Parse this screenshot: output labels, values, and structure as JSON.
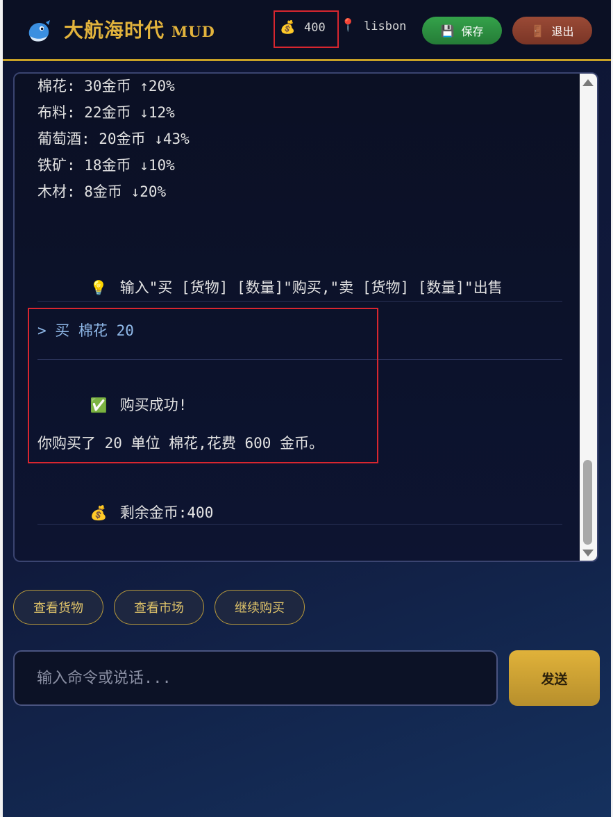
{
  "header": {
    "title": "大航海时代",
    "title_suffix": "MUD",
    "gold_icon": "💰",
    "gold": "400",
    "location_icon": "📍",
    "location": "lisbon",
    "save_icon": "💾",
    "save_label": "保存",
    "exit_icon": "🚪",
    "exit_label": "退出"
  },
  "log": {
    "market_lines": [
      "棉花: 30金币 ↑20%",
      "布料: 22金币 ↓12%",
      "葡萄酒: 20金币 ↓43%",
      "铁矿: 18金币 ↓10%",
      "木材: 8金币 ↓20%"
    ],
    "hint_icon": "💡",
    "hint": "输入\"买 [货物] [数量]\"购买,\"卖 [货物] [数量]\"出售",
    "command": "> 买 棉花 20",
    "success_icon": "✅",
    "success": "购买成功!",
    "detail": "你购买了 20 单位 棉花,花费 600 金币。",
    "remaining_icon": "💰",
    "remaining": "剩余金币:400"
  },
  "quick_actions": [
    "查看货物",
    "查看市场",
    "继续购买"
  ],
  "input": {
    "placeholder": "输入命令或说话...",
    "send_label": "发送"
  },
  "colors": {
    "accent_gold": "#e2b33c",
    "save_green": "#2f9a45",
    "exit_brown": "#8c4030",
    "highlight_red": "#d8262f"
  }
}
